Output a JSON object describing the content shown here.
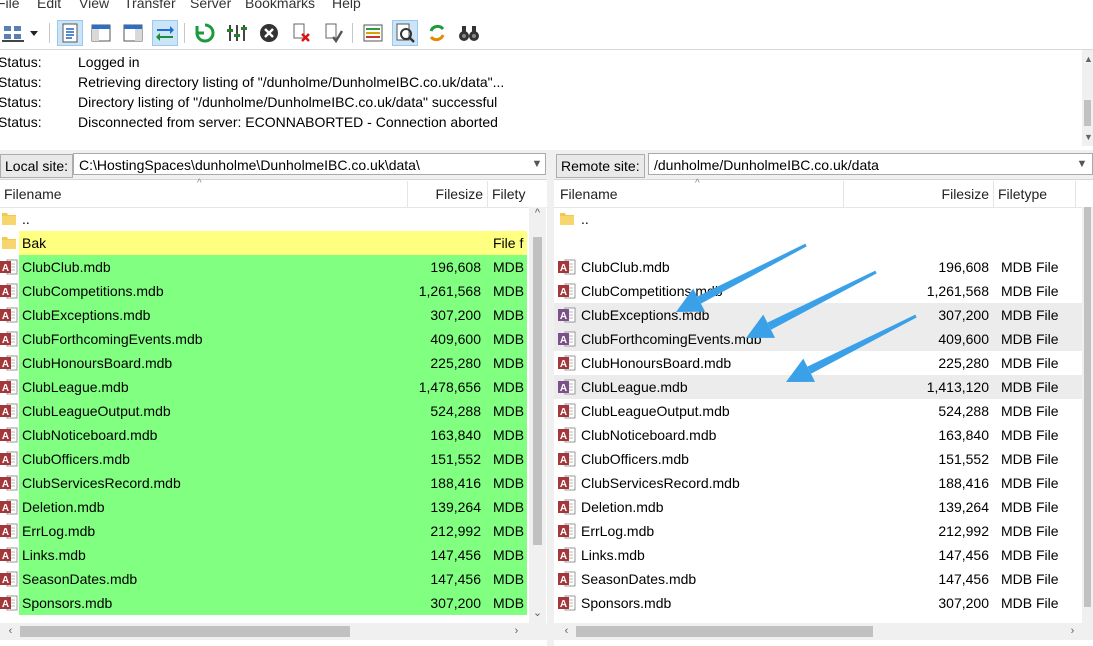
{
  "menu": [
    "File",
    "Edit",
    "View",
    "Transfer",
    "Server",
    "Bookmarks",
    "Help"
  ],
  "toolbar_icons": [
    "site-manager-icon",
    "dropdown-arrow-icon",
    "message-log-toggle-icon",
    "local-tree-toggle-icon",
    "remote-tree-toggle-icon",
    "transfer-queue-toggle-icon",
    "refresh-icon",
    "filter-icon",
    "cancel-icon",
    "disconnect-icon",
    "reconnect-icon",
    "directory-comparison-icon",
    "search-files-icon",
    "sync-browse-icon",
    "find-binoculars-icon"
  ],
  "colors": {
    "local_highlight": "#80ff80",
    "bak_highlight": "#ffff80",
    "arrow": "#3aa0e8",
    "selected_row": "#ececec"
  },
  "log": [
    {
      "key": "Status:",
      "value": "Logged in"
    },
    {
      "key": "Status:",
      "value": "Retrieving directory listing of \"/dunholme/DunholmeIBC.co.uk/data\"..."
    },
    {
      "key": "Status:",
      "value": "Directory listing of \"/dunholme/DunholmeIBC.co.uk/data\" successful"
    },
    {
      "key": "Status:",
      "value": "Disconnected from server: ECONNABORTED - Connection aborted"
    }
  ],
  "local": {
    "label": "Local site:",
    "path": "C:\\HostingSpaces\\dunholme\\DunholmeIBC.co.uk\\data\\",
    "columns": {
      "filename": "Filename",
      "filesize": "Filesize",
      "filetype": "Filety"
    },
    "rows": [
      {
        "name": "..",
        "size": "",
        "type": "",
        "kind": "folder",
        "hl": "none"
      },
      {
        "name": "Bak",
        "size": "",
        "type": "File f",
        "kind": "folder",
        "hl": "yellow"
      },
      {
        "name": "ClubClub.mdb",
        "size": "196,608",
        "type": "MDB",
        "kind": "db",
        "hl": "green"
      },
      {
        "name": "ClubCompetitions.mdb",
        "size": "1,261,568",
        "type": "MDB",
        "kind": "db",
        "hl": "green"
      },
      {
        "name": "ClubExceptions.mdb",
        "size": "307,200",
        "type": "MDB",
        "kind": "db",
        "hl": "green"
      },
      {
        "name": "ClubForthcomingEvents.mdb",
        "size": "409,600",
        "type": "MDB",
        "kind": "db",
        "hl": "green"
      },
      {
        "name": "ClubHonoursBoard.mdb",
        "size": "225,280",
        "type": "MDB",
        "kind": "db",
        "hl": "green"
      },
      {
        "name": "ClubLeague.mdb",
        "size": "1,478,656",
        "type": "MDB",
        "kind": "db",
        "hl": "green"
      },
      {
        "name": "ClubLeagueOutput.mdb",
        "size": "524,288",
        "type": "MDB",
        "kind": "db",
        "hl": "green"
      },
      {
        "name": "ClubNoticeboard.mdb",
        "size": "163,840",
        "type": "MDB",
        "kind": "db",
        "hl": "green"
      },
      {
        "name": "ClubOfficers.mdb",
        "size": "151,552",
        "type": "MDB",
        "kind": "db",
        "hl": "green"
      },
      {
        "name": "ClubServicesRecord.mdb",
        "size": "188,416",
        "type": "MDB",
        "kind": "db",
        "hl": "green"
      },
      {
        "name": "Deletion.mdb",
        "size": "139,264",
        "type": "MDB",
        "kind": "db",
        "hl": "green"
      },
      {
        "name": "ErrLog.mdb",
        "size": "212,992",
        "type": "MDB",
        "kind": "db",
        "hl": "green"
      },
      {
        "name": "Links.mdb",
        "size": "147,456",
        "type": "MDB",
        "kind": "db",
        "hl": "green"
      },
      {
        "name": "SeasonDates.mdb",
        "size": "147,456",
        "type": "MDB",
        "kind": "db",
        "hl": "green"
      },
      {
        "name": "Sponsors.mdb",
        "size": "307,200",
        "type": "MDB",
        "kind": "db",
        "hl": "green"
      }
    ]
  },
  "remote": {
    "label": "Remote site:",
    "path": "/dunholme/DunholmeIBC.co.uk/data",
    "columns": {
      "filename": "Filename",
      "filesize": "Filesize",
      "filetype": "Filetype"
    },
    "rows": [
      {
        "name": "..",
        "size": "",
        "type": "",
        "kind": "folder",
        "hl": "none"
      },
      {
        "name": "",
        "size": "",
        "type": "",
        "kind": "none",
        "hl": "none"
      },
      {
        "name": "ClubClub.mdb",
        "size": "196,608",
        "type": "MDB File",
        "kind": "db",
        "hl": "none"
      },
      {
        "name": "ClubCompetitions.mdb",
        "size": "1,261,568",
        "type": "MDB File",
        "kind": "db",
        "hl": "none"
      },
      {
        "name": "ClubExceptions.mdb",
        "size": "307,200",
        "type": "MDB File",
        "kind": "db2",
        "hl": "grey"
      },
      {
        "name": "ClubForthcomingEvents.mdb",
        "size": "409,600",
        "type": "MDB File",
        "kind": "db2",
        "hl": "grey"
      },
      {
        "name": "ClubHonoursBoard.mdb",
        "size": "225,280",
        "type": "MDB File",
        "kind": "db",
        "hl": "none"
      },
      {
        "name": "ClubLeague.mdb",
        "size": "1,413,120",
        "type": "MDB File",
        "kind": "db2",
        "hl": "grey"
      },
      {
        "name": "ClubLeagueOutput.mdb",
        "size": "524,288",
        "type": "MDB File",
        "kind": "db",
        "hl": "none"
      },
      {
        "name": "ClubNoticeboard.mdb",
        "size": "163,840",
        "type": "MDB File",
        "kind": "db",
        "hl": "none"
      },
      {
        "name": "ClubOfficers.mdb",
        "size": "151,552",
        "type": "MDB File",
        "kind": "db",
        "hl": "none"
      },
      {
        "name": "ClubServicesRecord.mdb",
        "size": "188,416",
        "type": "MDB File",
        "kind": "db",
        "hl": "none"
      },
      {
        "name": "Deletion.mdb",
        "size": "139,264",
        "type": "MDB File",
        "kind": "db",
        "hl": "none"
      },
      {
        "name": "ErrLog.mdb",
        "size": "212,992",
        "type": "MDB File",
        "kind": "db",
        "hl": "none"
      },
      {
        "name": "Links.mdb",
        "size": "147,456",
        "type": "MDB File",
        "kind": "db",
        "hl": "none"
      },
      {
        "name": "SeasonDates.mdb",
        "size": "147,456",
        "type": "MDB File",
        "kind": "db",
        "hl": "none"
      },
      {
        "name": "Sponsors.mdb",
        "size": "307,200",
        "type": "MDB File",
        "kind": "db",
        "hl": "none"
      }
    ]
  }
}
